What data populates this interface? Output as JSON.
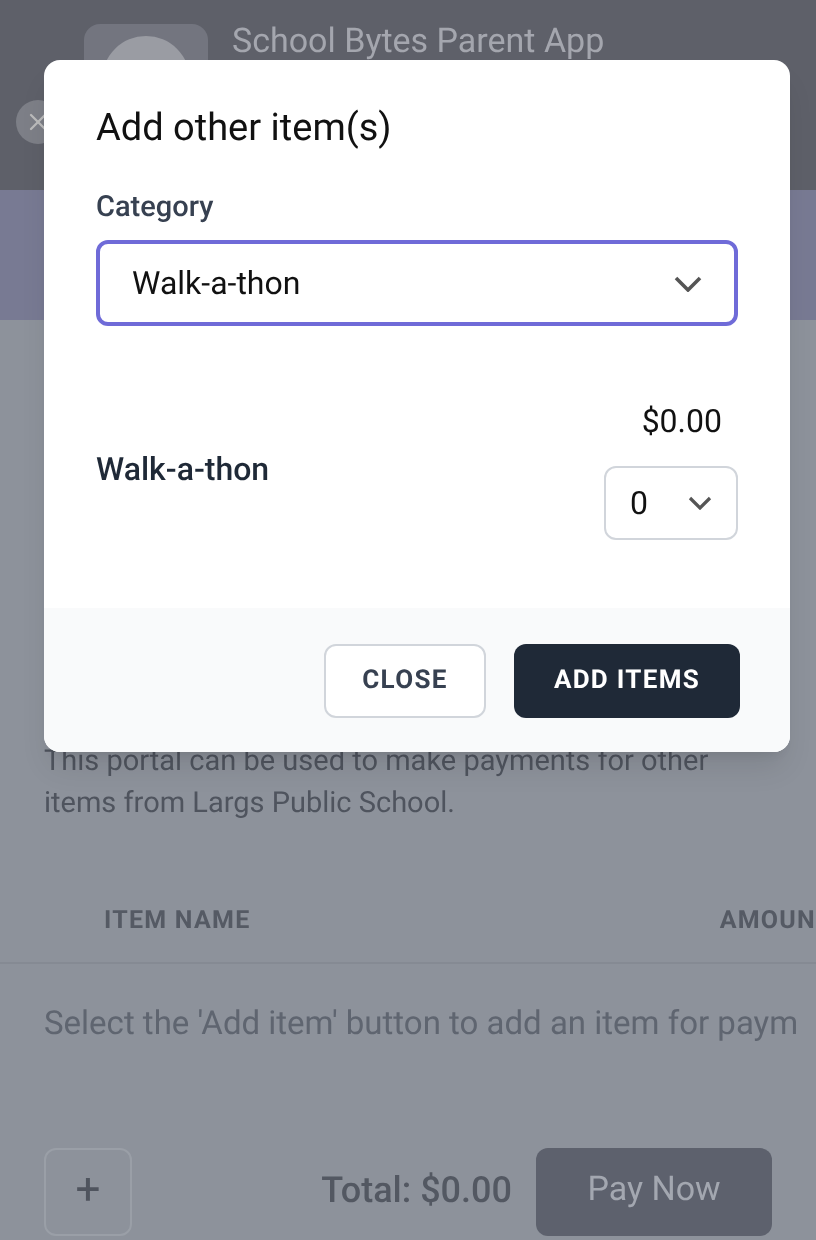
{
  "app_header": {
    "title": "School Bytes Parent App"
  },
  "page": {
    "intro": "This portal can be used to make payments for other items from Largs Public School.",
    "columns": [
      "ITEM NAME",
      "AMOUN"
    ],
    "empty_message": "Select the 'Add item' button to add an item for paym",
    "add_button": "+",
    "total": "Total: $0.00",
    "pay_button": {
      "label": "Pay Now",
      "disabled": true
    }
  },
  "dialog": {
    "title": "Add other item(s)",
    "category": {
      "label": "Category",
      "value": "Walk-a-thon",
      "focused": true
    },
    "items": [
      {
        "name": "Walk-a-thon",
        "price": "$0.00",
        "quantity": "0"
      }
    ],
    "buttons": [
      {
        "label": "CLOSE",
        "kind": "secondary"
      },
      {
        "label": "ADD ITEMS",
        "kind": "primary"
      }
    ]
  }
}
